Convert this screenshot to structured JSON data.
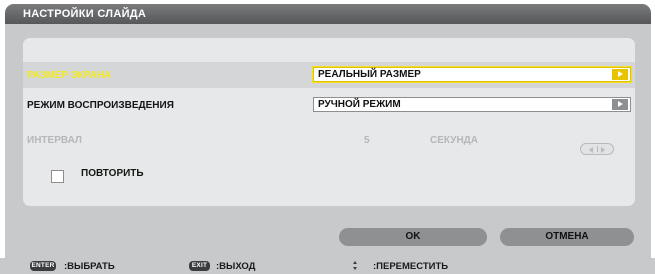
{
  "dialog": {
    "title": "НАСТРОЙКИ СЛАЙДА"
  },
  "settings": {
    "screen_size": {
      "label": "РАЗМЕР ЭКРАНА",
      "value": "РЕАЛЬНЫЙ РАЗМЕР",
      "selected": true
    },
    "playback_mode": {
      "label": "РЕЖИМ ВОСПРОИЗВЕДЕНИЯ",
      "value": "РУЧНОЙ РЕЖИМ"
    },
    "interval": {
      "label": "ИНТЕРВАЛ",
      "value": "5",
      "unit": "СЕКУНДА",
      "enabled": false
    },
    "repeat": {
      "label": "ПОВТОРИТЬ",
      "checked": false
    }
  },
  "buttons": {
    "ok": "OK",
    "cancel": "ОТМЕНА"
  },
  "footer": {
    "enter_key": "ENTER",
    "enter_label": ":ВЫБРАТЬ",
    "exit_key": "EXIT",
    "exit_label": ":ВЫХОД",
    "move_label": ":ПЕРЕМЕСТИТЬ"
  },
  "colors": {
    "highlight_text": "#f3ea1f",
    "highlight_arrow": "#e7c400",
    "disabled_text": "#b6b7b9",
    "button": "#8f9092",
    "titlebar": "#5f6063"
  }
}
